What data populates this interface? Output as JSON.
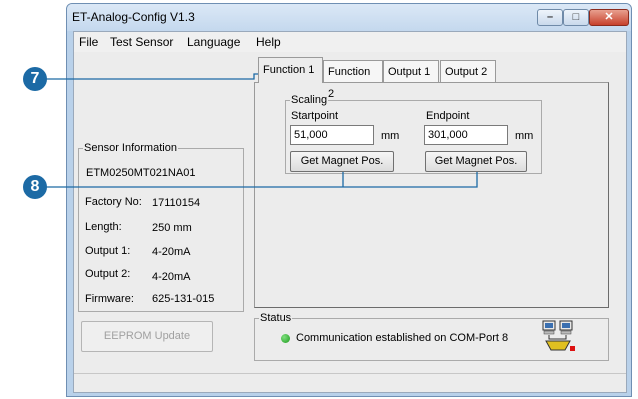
{
  "window": {
    "title": "ET-Analog-Config V1.3",
    "buttons": {
      "minimize": "–",
      "maximize": "□",
      "close": "✕"
    }
  },
  "menu": [
    "File",
    "Test Sensor",
    "Language",
    "Help"
  ],
  "tabs": [
    "Function 1",
    "Function 2",
    "Output 1",
    "Output 2"
  ],
  "scaling": {
    "legend": "Scaling",
    "startpoint": {
      "label": "Startpoint",
      "value": "51,000",
      "unit": "mm",
      "button": "Get Magnet Pos."
    },
    "endpoint": {
      "label": "Endpoint",
      "value": "301,000",
      "unit": "mm",
      "button": "Get Magnet Pos."
    }
  },
  "sensor_info": {
    "legend": "Sensor Information",
    "model": "ETM0250MT021NA01",
    "rows": [
      {
        "label": "Factory No:",
        "value": "17110154"
      },
      {
        "label": "Length:",
        "value": "250 mm"
      },
      {
        "label": "Output 1:",
        "value": "4-20mA"
      },
      {
        "label": "Output 2:",
        "value": "4-20mA"
      },
      {
        "label": "Firmware:",
        "value": "625-131-015"
      }
    ]
  },
  "eeprom_button": "EEPROM Update",
  "status": {
    "legend": "Status",
    "message": "Communication established on COM-Port 8",
    "led_color": "#2aa82a"
  },
  "callouts": [
    "7",
    "8"
  ],
  "colors": {
    "callout": "#1c6aa5",
    "window_frame": "#b9d1ea",
    "close_button": "#c7412c"
  }
}
